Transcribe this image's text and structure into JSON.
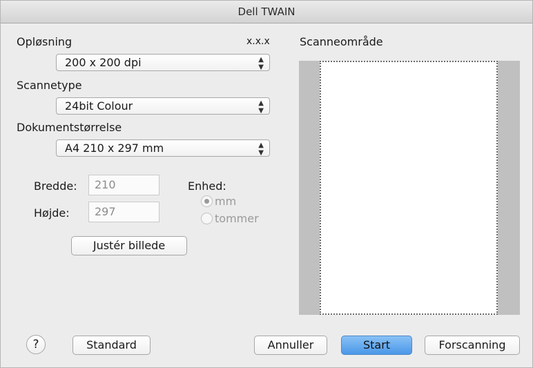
{
  "window": {
    "title": "Dell TWAIN"
  },
  "left": {
    "resolution_label": "Opløsning",
    "version": "x.x.x",
    "resolution_value": "200 x 200 dpi",
    "scantype_label": "Scannetype",
    "scantype_value": "24bit Colour",
    "docsize_label": "Dokumentstørrelse",
    "docsize_value": "A4  210 x 297 mm",
    "width_label": "Bredde:",
    "width_value": "210",
    "height_label": "Højde:",
    "height_value": "297",
    "unit_label": "Enhed:",
    "unit_mm": "mm",
    "unit_inch": "tommer",
    "unit_selected": "mm",
    "adjust_button": "Justér billede"
  },
  "right": {
    "scan_area_label": "Scanneområde"
  },
  "footer": {
    "help": "?",
    "default_button": "Standard",
    "cancel_button": "Annuller",
    "start_button": "Start",
    "prescan_button": "Forscanning"
  },
  "icons": {
    "popup_arrows": "updown-chevron-icon",
    "help": "question-mark-icon"
  }
}
